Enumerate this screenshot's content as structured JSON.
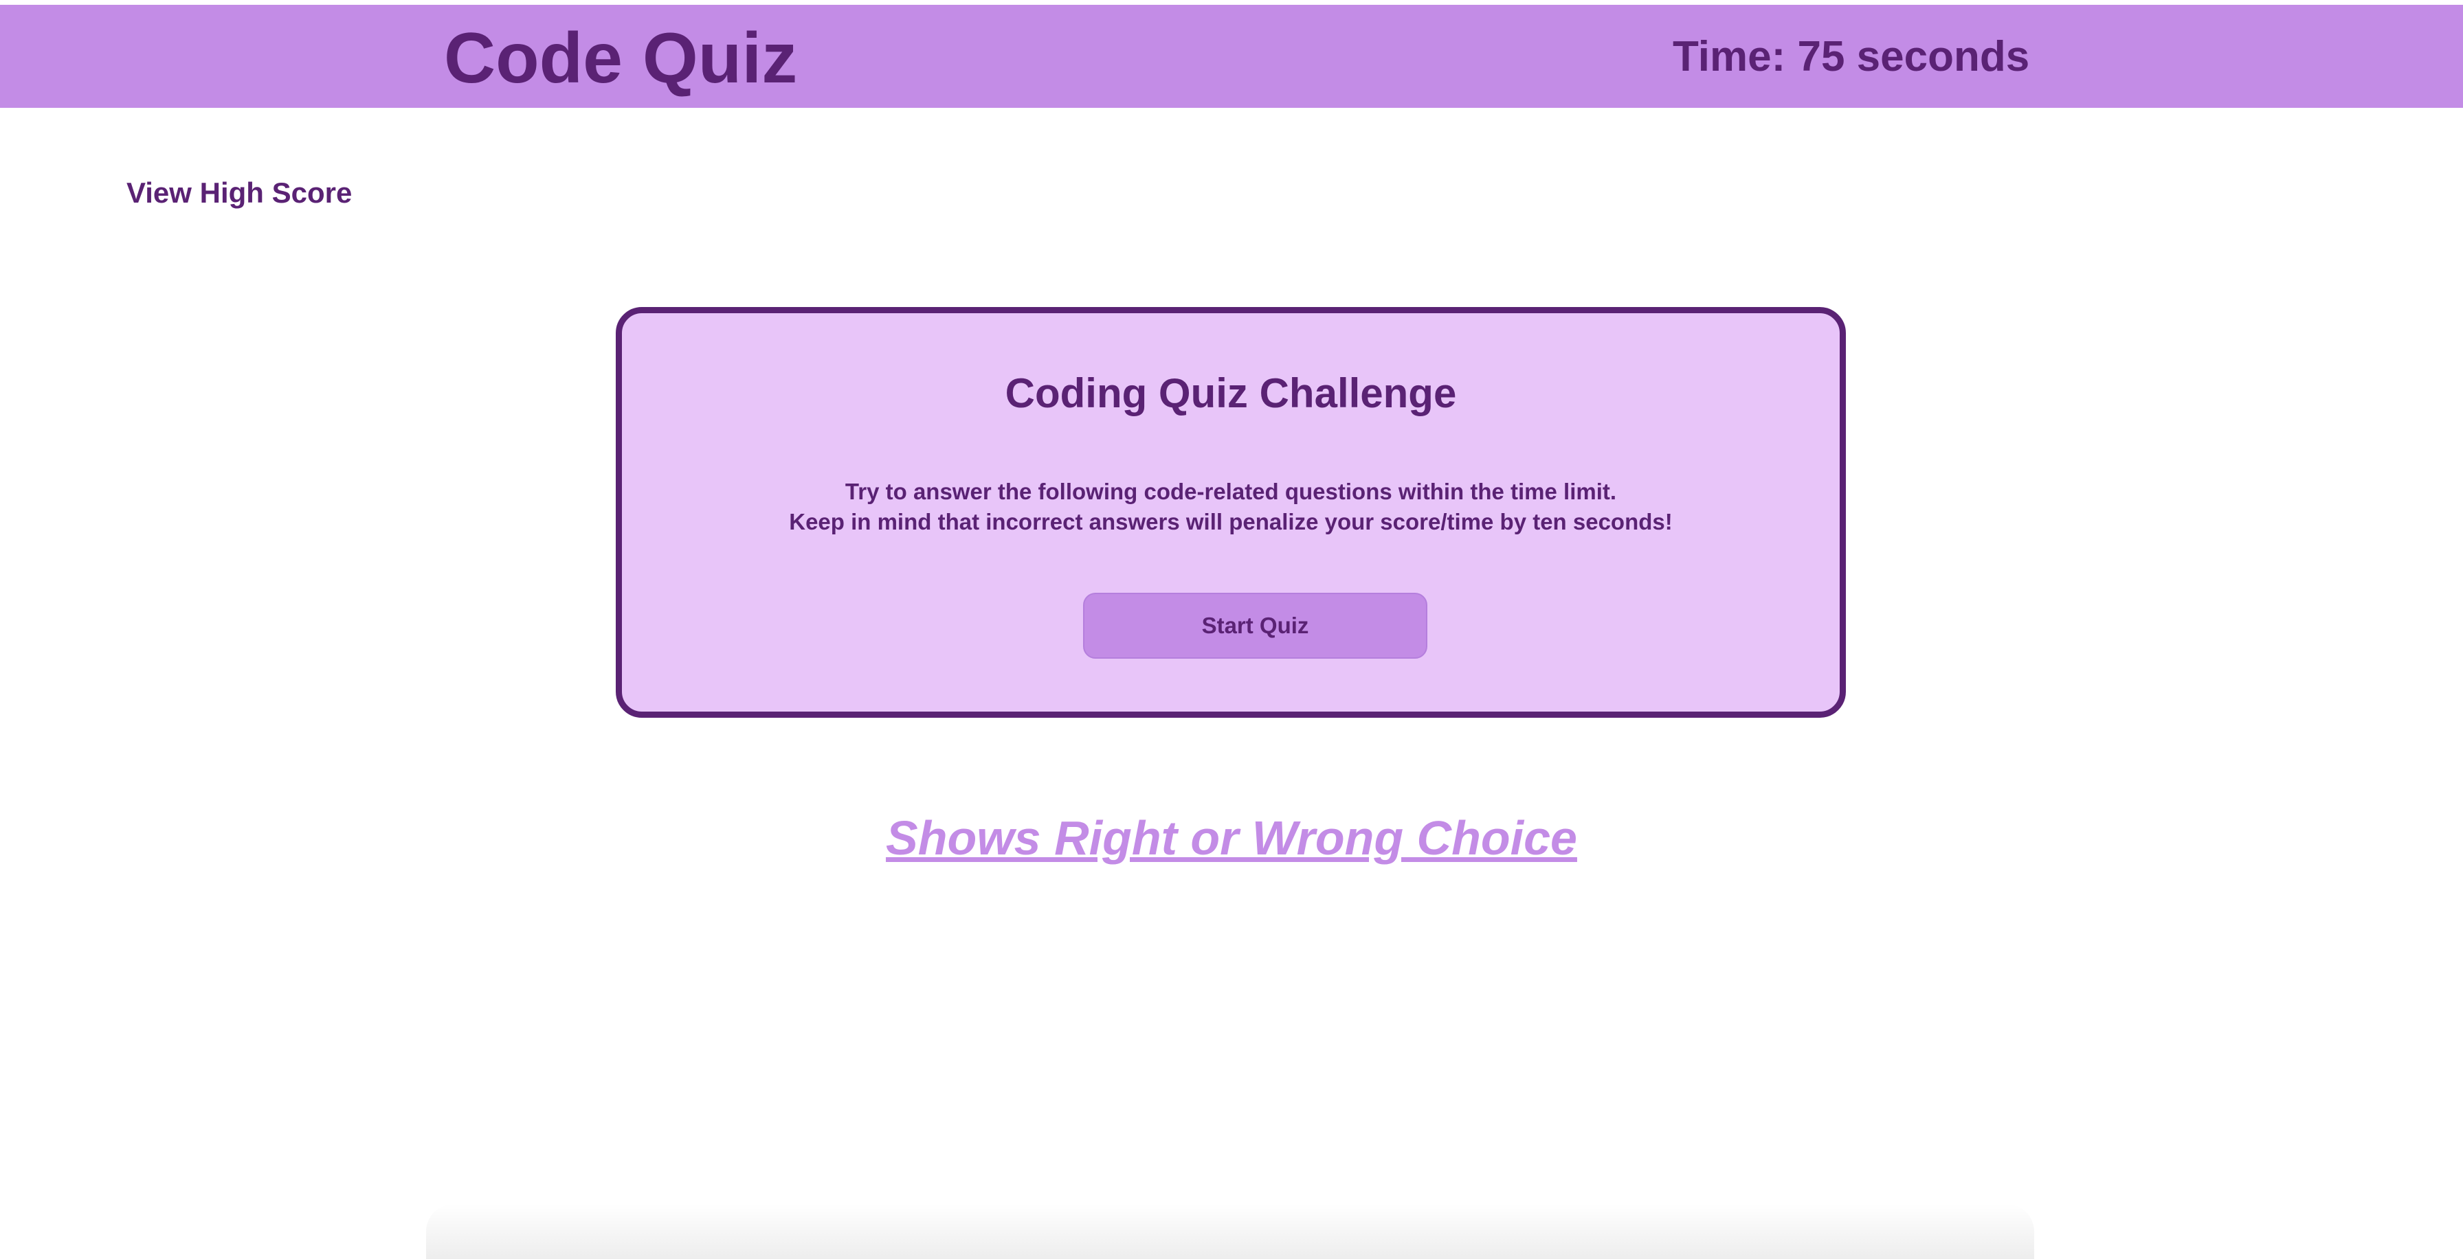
{
  "header": {
    "title": "Code Quiz",
    "timer": "Time: 75 seconds"
  },
  "nav": {
    "high_score_label": "View High Score"
  },
  "card": {
    "title": "Coding Quiz Challenge",
    "instructions_line1": "Try to answer the following code-related questions within the time limit.",
    "instructions_line2": "Keep in mind that incorrect answers will penalize your score/time by ten seconds!",
    "start_button_label": "Start Quiz"
  },
  "feedback": {
    "text": "Shows Right or Wrong Choice"
  },
  "colors": {
    "header_bg": "#c38ce6",
    "primary_text": "#5a2274",
    "card_bg": "#e8c5f9",
    "card_border": "#5a2274",
    "button_bg": "#c38ce6",
    "feedback_text": "#c38ce6"
  }
}
